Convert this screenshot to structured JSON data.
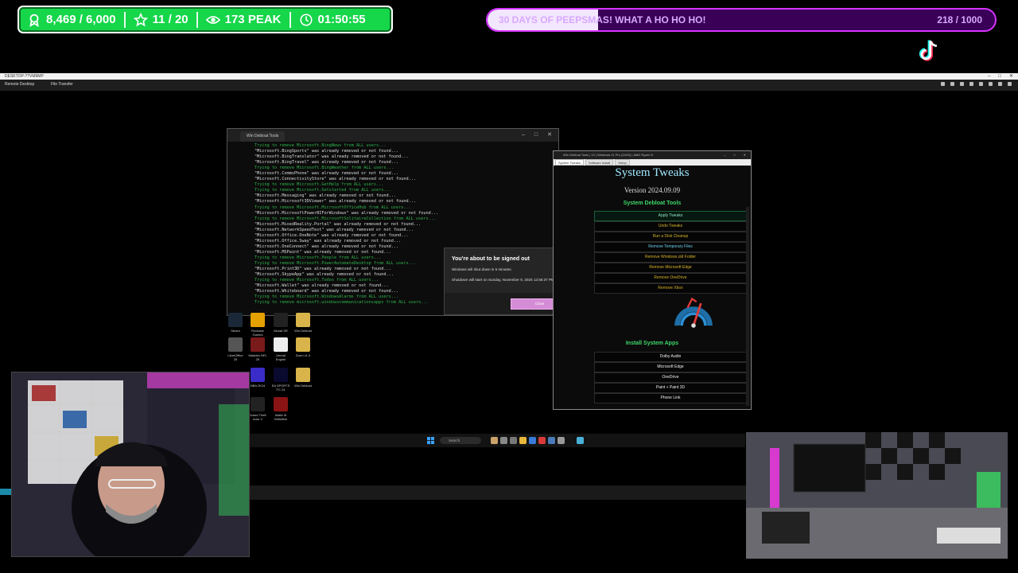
{
  "stats": {
    "followers": "8,469 / 6,000",
    "subs": "11 / 20",
    "viewers": "173 PEAK",
    "uptime": "01:50:55"
  },
  "goal": {
    "title": "30 DAYS OF PEEPSMAS! WHAT A HO HO HO!",
    "count": "218 / 1000",
    "progress": 0.218
  },
  "remote_desktop": {
    "title": "DESKTOP-??VM9MP",
    "tabs": [
      "Remote Desktop",
      "File Transfer"
    ]
  },
  "terminal": {
    "tab_label": "Win Debloat Tools",
    "lines": [
      {
        "t": "Trying to remove Microsoft.BingNews from ALL users...",
        "c": "g"
      },
      {
        "t": "\"Microsoft.BingSports\" was already removed or not found...",
        "c": "w"
      },
      {
        "t": "\"Microsoft.BingTranslator\" was already removed or not found...",
        "c": "w"
      },
      {
        "t": "\"Microsoft.BingTravel\" was already removed or not found...",
        "c": "w"
      },
      {
        "t": "Trying to remove Microsoft.BingWeather from ALL users...",
        "c": "g"
      },
      {
        "t": "\"Microsoft.CommsPhone\" was already removed or not found...",
        "c": "w"
      },
      {
        "t": "\"Microsoft.ConnectivityStore\" was already removed or not found...",
        "c": "w"
      },
      {
        "t": "Trying to remove Microsoft.GetHelp from ALL users...",
        "c": "g"
      },
      {
        "t": "Trying to remove Microsoft.Getstarted from ALL users...",
        "c": "g"
      },
      {
        "t": "\"Microsoft.Messaging\" was already removed or not found...",
        "c": "w"
      },
      {
        "t": "\"Microsoft.Microsoft3DViewer\" was already removed or not found...",
        "c": "w"
      },
      {
        "t": "Trying to remove Microsoft.MicrosoftOfficeHub from ALL users...",
        "c": "g"
      },
      {
        "t": "\"Microsoft.MicrosoftPowerBIForWindows\" was already removed or not found...",
        "c": "w"
      },
      {
        "t": "Trying to remove Microsoft.MicrosoftSolitaireCollection from ALL users...",
        "c": "g"
      },
      {
        "t": "\"Microsoft.MixedReality.Portal\" was already removed or not found...",
        "c": "w"
      },
      {
        "t": "\"Microsoft.NetworkSpeedTest\" was already removed or not found...",
        "c": "w"
      },
      {
        "t": "\"Microsoft.Office.OneNote\" was already removed or not found...",
        "c": "w"
      },
      {
        "t": "\"Microsoft.Office.Sway\" was already removed or not found...",
        "c": "w"
      },
      {
        "t": "\"Microsoft.OneConnect\" was already removed or not found...",
        "c": "w"
      },
      {
        "t": "\"Microsoft.MSPaint\" was already removed or not found...",
        "c": "w"
      },
      {
        "t": "Trying to remove Microsoft.People from ALL users...",
        "c": "g"
      },
      {
        "t": "Trying to remove Microsoft.PowerAutomateDesktop from ALL users...",
        "c": "g"
      },
      {
        "t": "\"Microsoft.Print3D\" was already removed or not found...",
        "c": "w"
      },
      {
        "t": "\"Microsoft.SkypeApp\" was already removed or not found...",
        "c": "w"
      },
      {
        "t": "Trying to remove Microsoft.Todos from ALL users...",
        "c": "g"
      },
      {
        "t": "\"Microsoft.Wallet\" was already removed or not found...",
        "c": "w"
      },
      {
        "t": "\"Microsoft.Whiteboard\" was already removed or not found...",
        "c": "w"
      },
      {
        "t": "Trying to remove Microsoft.WindowsAlarms from ALL users...",
        "c": "g"
      },
      {
        "t": "Trying to remove microsoft.windowscommunicationsapps from ALL users...",
        "c": "g"
      }
    ]
  },
  "dialog": {
    "heading": "You're about to be signed out",
    "line1": "Windows will shut down in 5 minutes.",
    "line2": "Shutdown will start on Sunday, November 9, 2025 12:56:37 PM.",
    "button": "Close"
  },
  "debloat": {
    "window_title": "Win Debloat Tools | 10 | Windows 11 Pro (24H2) | AMD Ryzen 9",
    "tabs": [
      "System Tweaks",
      "Software Install",
      "Setup"
    ],
    "title": "System Tweaks",
    "version": "Version 2024.09.09",
    "section1": "System Debloat Tools",
    "tools": [
      "Apply Tweaks",
      "Undo Tweaks",
      "Run a Disk Cleanup",
      "Remove Temporary Files",
      "Remove Windows.old Folder",
      "Remove Microsoft Edge",
      "Remove OneDrive",
      "Remove Xbox"
    ],
    "section2": "Install System Apps",
    "apps": [
      "Dolby Audio",
      "Microsoft Edge",
      "OneDrive",
      "Paint + Paint 3D",
      "Phone Link"
    ]
  },
  "desktop_icons": [
    {
      "label": "Steam",
      "color": "#1b2838"
    },
    {
      "label": "Rockstar Games",
      "color": "#e2a100"
    },
    {
      "label": "Musat SR",
      "color": "#222"
    },
    {
      "label": "Win Debloat",
      "color": "#d9b44a"
    },
    {
      "label": "LibreOffice 25",
      "color": "#555"
    },
    {
      "label": "Madden NFL 25",
      "color": "#7a1b1b"
    },
    {
      "label": "Unreal Engine",
      "color": "#eee"
    },
    {
      "label": "Drum v1.0",
      "color": "#d9b44a"
    },
    {
      "label": "NBA 2K24",
      "color": "#3a2cc8"
    },
    {
      "label": "EA SPORTS FC 24",
      "color": "#0a0a30"
    },
    {
      "label": "Win Debloat",
      "color": "#d9b44a"
    },
    {
      "label": "Grand Theft Auto V",
      "color": "#222"
    },
    {
      "label": "Mafia III Definitive",
      "color": "#8a1414"
    }
  ],
  "taskbar": {
    "search_placeholder": "Search"
  },
  "colors": {
    "stats_bg": "#16d64a",
    "goal_border": "#d634ff",
    "goal_bg": "#3a0058",
    "accent_green": "#3ed86a",
    "title_cyan": "#9fe7ff"
  }
}
